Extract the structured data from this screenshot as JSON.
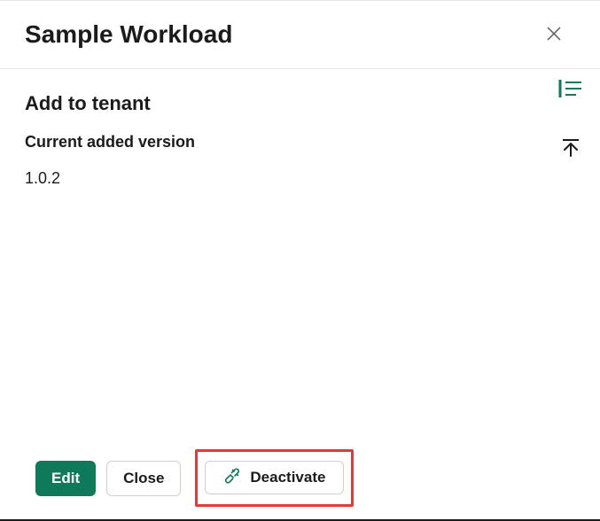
{
  "header": {
    "title": "Sample Workload"
  },
  "main": {
    "section_title": "Add to tenant",
    "version_label": "Current added version",
    "version_value": "1.0.2"
  },
  "footer": {
    "edit_label": "Edit",
    "close_label": "Close",
    "deactivate_label": "Deactivate"
  },
  "colors": {
    "primary": "#0f7a5a",
    "highlight": "#e53935"
  }
}
